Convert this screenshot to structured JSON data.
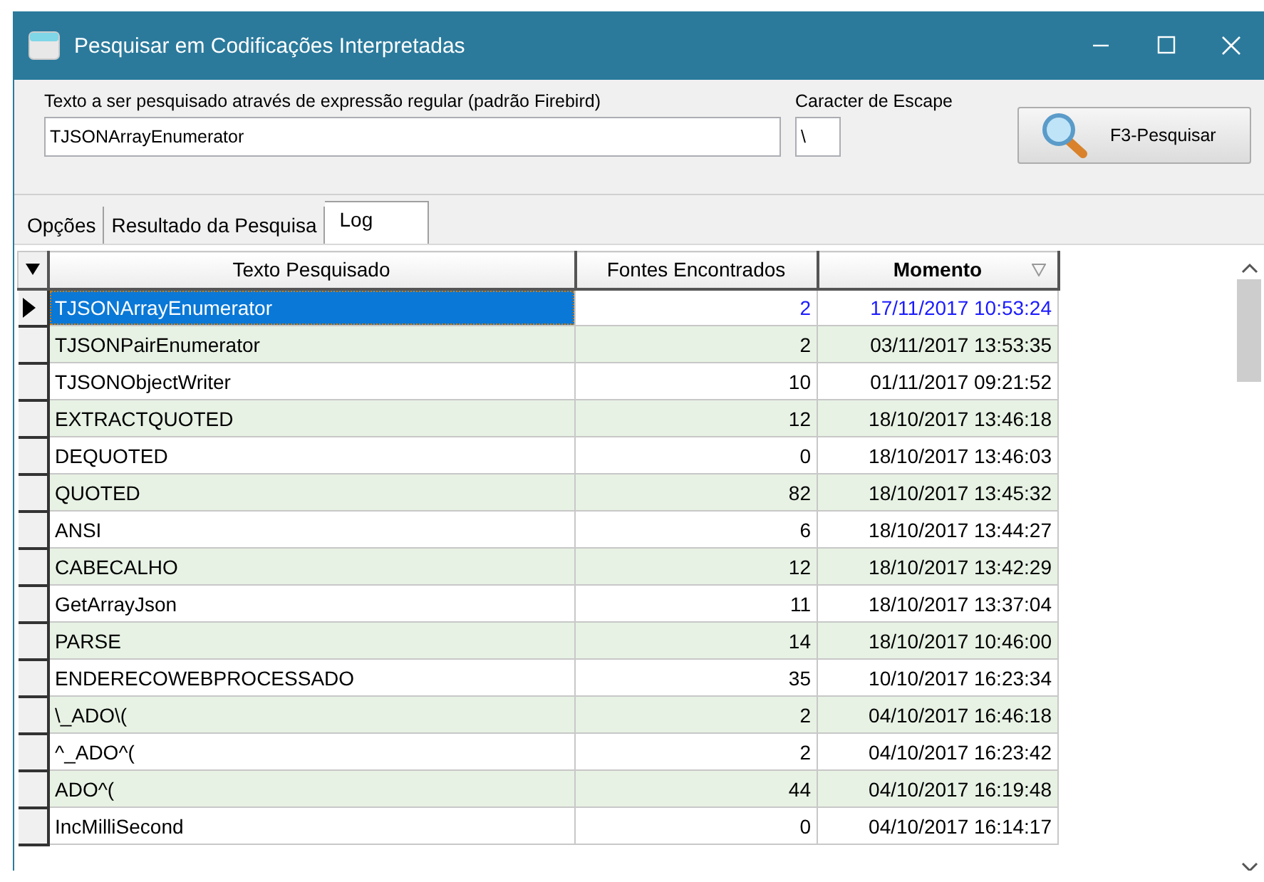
{
  "window": {
    "title": "Pesquisar em Codificações Interpretadas"
  },
  "search": {
    "label": "Texto a ser pesquisado através de expressão regular (padrão Firebird)",
    "value": "TJSONArrayEnumerator"
  },
  "escape": {
    "label": "Caracter de Escape",
    "value": "\\"
  },
  "search_button": {
    "label": "F3-Pesquisar"
  },
  "tabs": [
    {
      "label": "Opções",
      "selected": false
    },
    {
      "label": "Resultado da Pesquisa",
      "selected": false
    },
    {
      "label": "Log",
      "selected": true
    }
  ],
  "grid": {
    "columns": [
      {
        "label": "Texto Pesquisado",
        "sorted": false
      },
      {
        "label": "Fontes Encontrados",
        "sorted": false
      },
      {
        "label": "Momento",
        "sorted": true
      }
    ],
    "rows": [
      {
        "text": "TJSONArrayEnumerator",
        "count": "2",
        "moment": "17/11/2017 10:53:24",
        "selected": true
      },
      {
        "text": "TJSONPairEnumerator",
        "count": "2",
        "moment": "03/11/2017 13:53:35",
        "selected": false
      },
      {
        "text": "TJSONObjectWriter",
        "count": "10",
        "moment": "01/11/2017 09:21:52",
        "selected": false
      },
      {
        "text": "EXTRACTQUOTED",
        "count": "12",
        "moment": "18/10/2017 13:46:18",
        "selected": false
      },
      {
        "text": "DEQUOTED",
        "count": "0",
        "moment": "18/10/2017 13:46:03",
        "selected": false
      },
      {
        "text": "QUOTED",
        "count": "82",
        "moment": "18/10/2017 13:45:32",
        "selected": false
      },
      {
        "text": "ANSI",
        "count": "6",
        "moment": "18/10/2017 13:44:27",
        "selected": false
      },
      {
        "text": "CABECALHO",
        "count": "12",
        "moment": "18/10/2017 13:42:29",
        "selected": false
      },
      {
        "text": "GetArrayJson",
        "count": "11",
        "moment": "18/10/2017 13:37:04",
        "selected": false
      },
      {
        "text": "PARSE",
        "count": "14",
        "moment": "18/10/2017 10:46:00",
        "selected": false
      },
      {
        "text": "ENDERECOWEBPROCESSADO",
        "count": "35",
        "moment": "10/10/2017 16:23:34",
        "selected": false
      },
      {
        "text": "\\_ADO\\(",
        "count": "2",
        "moment": "04/10/2017 16:46:18",
        "selected": false
      },
      {
        "text": "^_ADO^(",
        "count": "2",
        "moment": "04/10/2017 16:23:42",
        "selected": false
      },
      {
        "text": "ADO^(",
        "count": "44",
        "moment": "04/10/2017 16:19:48",
        "selected": false
      },
      {
        "text": "IncMilliSecond",
        "count": "0",
        "moment": "04/10/2017 16:14:17",
        "selected": false
      }
    ]
  }
}
